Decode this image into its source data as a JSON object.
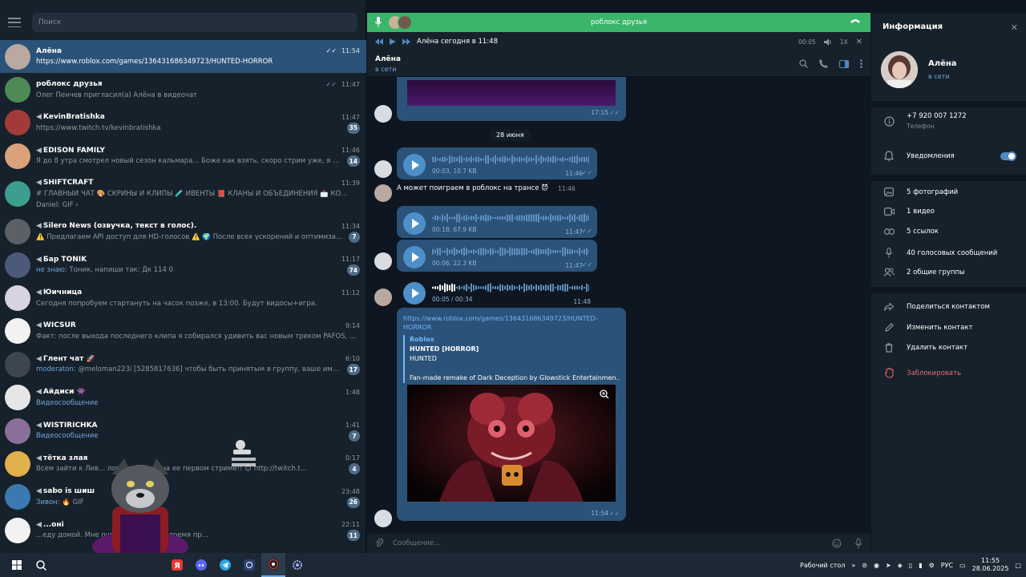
{
  "search": {
    "placeholder": "Поиск"
  },
  "chats": [
    {
      "name": "Алёна",
      "time": "11:54",
      "check": "✓✓",
      "preview": "https://www.roblox.com/games/136431686349723/HUNTED-HORROR",
      "active": true,
      "avatar_color": "#b9a9a0"
    },
    {
      "name": "роблокс друзья",
      "time": "11:47",
      "check": "✓✓",
      "preview": "Олег Пенчев пригласил(а) Алёна в видеочат",
      "avatar_color": "#4d8a55"
    },
    {
      "name": "KevinBratishka",
      "time": "11:47",
      "preview": "https://www.twitch.tv/kevinbratishka",
      "badge": "35",
      "avatar_color": "#a23a3a"
    },
    {
      "name": "EDISON FAMILY",
      "time": "11:46",
      "preview": "Я до 8 утра смотрел новый сезон кальмара... Боже как взять, скоро стрим уже, я только о...",
      "badge": "14",
      "avatar_color": "#d9a27a"
    },
    {
      "name": "SHIFTCRAFT",
      "time": "11:39",
      "preview": "# ГЛАВНЫЙ ЧАТ  🎨 СКРИНЫ И КЛИПЫ  🧪 ИВЕНТЫ  📕 КЛАНЫ И ОБЪЕДИНЕНИЯ  📩 КО...",
      "preview2": "Daniel: GIF ›",
      "tall": true,
      "avatar_color": "#3c9e8c"
    },
    {
      "name": "Silero News (озвучка, текст в голос).",
      "time": "11:34",
      "preview": "⚠️ Предлагаем API доступ для HD-голосов ⚠️ 🌍 После всех ускорений и оптимизаций...",
      "badge": "7",
      "avatar_color": "#5b5f66"
    },
    {
      "name": "Бар TONIK",
      "time": "11:17",
      "sender": "не знаю:",
      "preview": "Тоник, напиши так: Дк 114 0",
      "badge": "74",
      "avatar_color": "#4c5a7a"
    },
    {
      "name": "Юичница",
      "time": "11:12",
      "preview": "Сегодня попробуем стартануть на часок позже, в 13:00. Будут видосы+игра.",
      "avatar_color": "#d7d3e0"
    },
    {
      "name": "WICSUR",
      "time": "9:14",
      "preview": "Факт: после выхода последнего клипа я собирался удивить вас новым треком PAFOS, им...",
      "avatar_color": "#f2f2f2"
    },
    {
      "name": "Глент чат 🚀",
      "time": "6:10",
      "sender": "moderaton:",
      "preview": "@meloman223i [5285817636] чтобы быть принятым в группу, ваше имя и фамил...",
      "badge": "17",
      "avatar_color": "#3d4550"
    },
    {
      "name": "Айдиси 👾",
      "time": "1:48",
      "preview": "Видеосообщение",
      "previewBlue": true,
      "avatar_color": "#e6e6e6"
    },
    {
      "name": "WISTIRICHKA",
      "time": "1:41",
      "preview": "Видеосообщение",
      "previewBlue": true,
      "badge": "7",
      "avatar_color": "#8a6f9a"
    },
    {
      "name": "тётка злая",
      "time": "0:17",
      "preview": "Всем зайти к Лив... ловом добрым на ее первом стриме!! 😊 http://twitch.t...",
      "badge": "4",
      "avatar_color": "#e0b04c"
    },
    {
      "name": "sabo is шиш",
      "time": "23:48",
      "sender": "Зивон:",
      "preview": "🔥 GIF",
      "badge": "26",
      "avatar_color": "#3a7ab0"
    },
    {
      "name": "...онi",
      "time": "22:11",
      "preview": "...еду домой. Мне очень грустно что время пр...",
      "badge": "11",
      "avatar_color": "#f2f2f2"
    }
  ],
  "call": {
    "title": "роблокс друзья"
  },
  "player": {
    "title": "Алёна сегодня в 11:48",
    "time": "00:05",
    "speed": "1X"
  },
  "header": {
    "name": "Алёна",
    "status": "в сети"
  },
  "messages": {
    "top_time": "17:15",
    "date": "28 июня",
    "voice1": {
      "meta": "00:03, 10.7 KB",
      "time": "11:46"
    },
    "incoming": {
      "text": "А может поиграем в роблокс на трансе 😈",
      "time": "11:46"
    },
    "voice2": {
      "meta": "00:18, 67.9 KB",
      "time": "11:47"
    },
    "voice3": {
      "meta": "00:06, 22.3 KB",
      "time": "11:47"
    },
    "voice4": {
      "meta": "00:05 / 00:34",
      "time": "11:48"
    },
    "link": {
      "url": "https://www.roblox.com/games/136431686349723/HUNTED-HORROR",
      "site": "Roblox",
      "title": "HUNTED [HORROR]",
      "desc": "HUNTED",
      "desc2": "Fan-made remake of Dark Deception by Glowstick Entertainmen...",
      "time": "11:54"
    }
  },
  "composer": {
    "placeholder": "Сообщение..."
  },
  "info": {
    "title": "Информация",
    "name": "Алёна",
    "status": "в сети",
    "phone": "+7 920 007 1272",
    "phone_label": "Телефон",
    "notifications": "Уведомления",
    "photos": "5 фотографий",
    "videos": "1 видео",
    "links": "5 ссылок",
    "voices": "40 голосовых сообщений",
    "groups": "2 общие группы",
    "share": "Поделиться контактом",
    "edit": "Изменить контакт",
    "delete": "Удалить контакт",
    "block": "Заблокировать"
  },
  "taskbar": {
    "desktop": "Рабочий стол",
    "lang": "РУС",
    "time": "11:55",
    "date": "28.06.2025"
  },
  "colors": {
    "accent": "#5288c1",
    "bubble": "#2b5278",
    "call_green": "#3ab56a",
    "danger": "#e06c6c"
  }
}
